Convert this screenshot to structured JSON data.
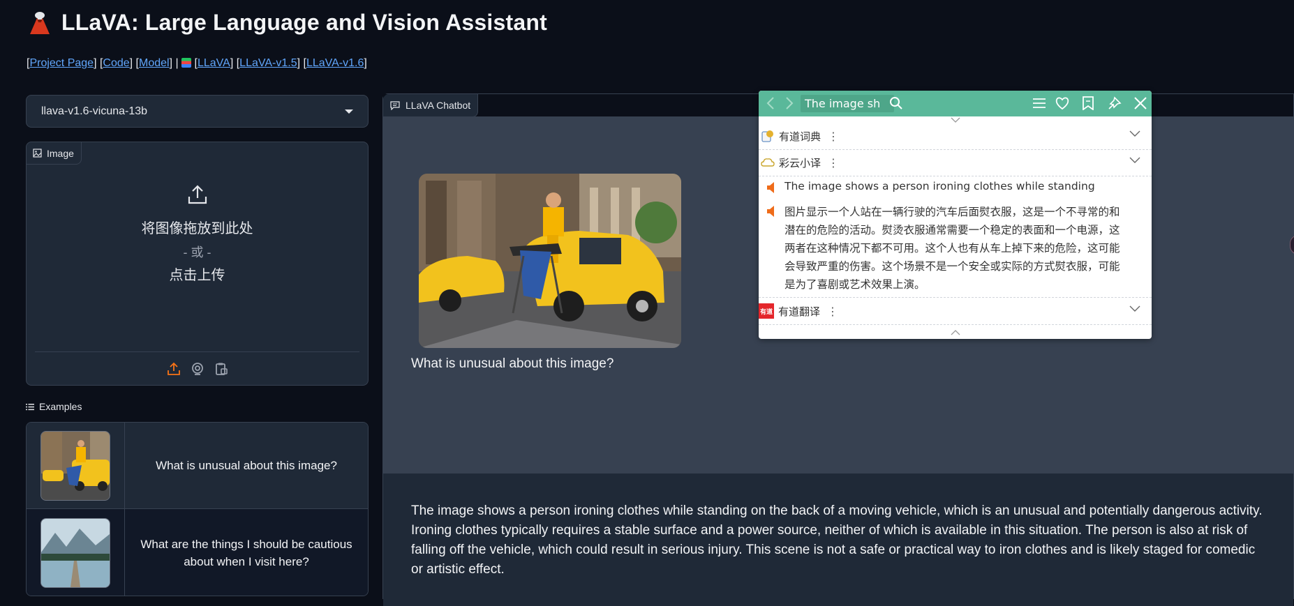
{
  "header": {
    "title": "LLaVA: Large Language and Vision Assistant",
    "links": [
      {
        "label": "Project Page"
      },
      {
        "label": "Code"
      },
      {
        "label": "Model"
      },
      {
        "label": "LLaVA"
      },
      {
        "label": "LLaVA-v1.5"
      },
      {
        "label": "LLaVA-v1.6"
      }
    ]
  },
  "model_select": {
    "value": "llava-v1.6-vicuna-13b"
  },
  "image_panel": {
    "label": "Image",
    "drop_title": "将图像拖放到此处",
    "drop_or": "- 或 -",
    "drop_click": "点击上传"
  },
  "examples": {
    "label": "Examples",
    "rows": [
      {
        "text": "What is unusual about this image?"
      },
      {
        "text": "What are the things I should be cautious about when I visit here?"
      }
    ]
  },
  "chat": {
    "label": "LLaVA Chatbot",
    "user_question": "What is unusual about this image?",
    "bot_answer": "The image shows a person ironing clothes while standing on the back of a moving vehicle, which is an unusual and potentially dangerous activity. Ironing clothes typically requires a stable surface and a power source, neither of which is available in this situation. The person is also at risk of falling off the vehicle, which could result in serious injury. This scene is not a safe or practical way to iron clothes and is likely staged for comedic or artistic effect."
  },
  "popup": {
    "search_value": "The image sh",
    "sections": [
      {
        "name": "有道词典"
      },
      {
        "name": "彩云小译"
      },
      {
        "name": "有道翻译"
      }
    ],
    "translation_en": "The image shows a person ironing clothes while standing on th",
    "translation_zh": "图片显示一个人站在一辆行驶的汽车后面熨衣服，这是一个不寻常的和潜在的危险的活动。熨烫衣服通常需要一个稳定的表面和一个电源，这两者在这种情况下都不可用。这个人也有从车上掉下来的危险，这可能会导致严重的伤害。这个场景不是一个安全或实际的方式熨衣服，可能是为了喜剧或艺术效果上演。",
    "accent_color": "#5ab89a"
  },
  "colors": {
    "background": "#0b0f19",
    "panel": "#1f2937",
    "link": "#60a5fa",
    "upload_icon": "#f97316"
  }
}
